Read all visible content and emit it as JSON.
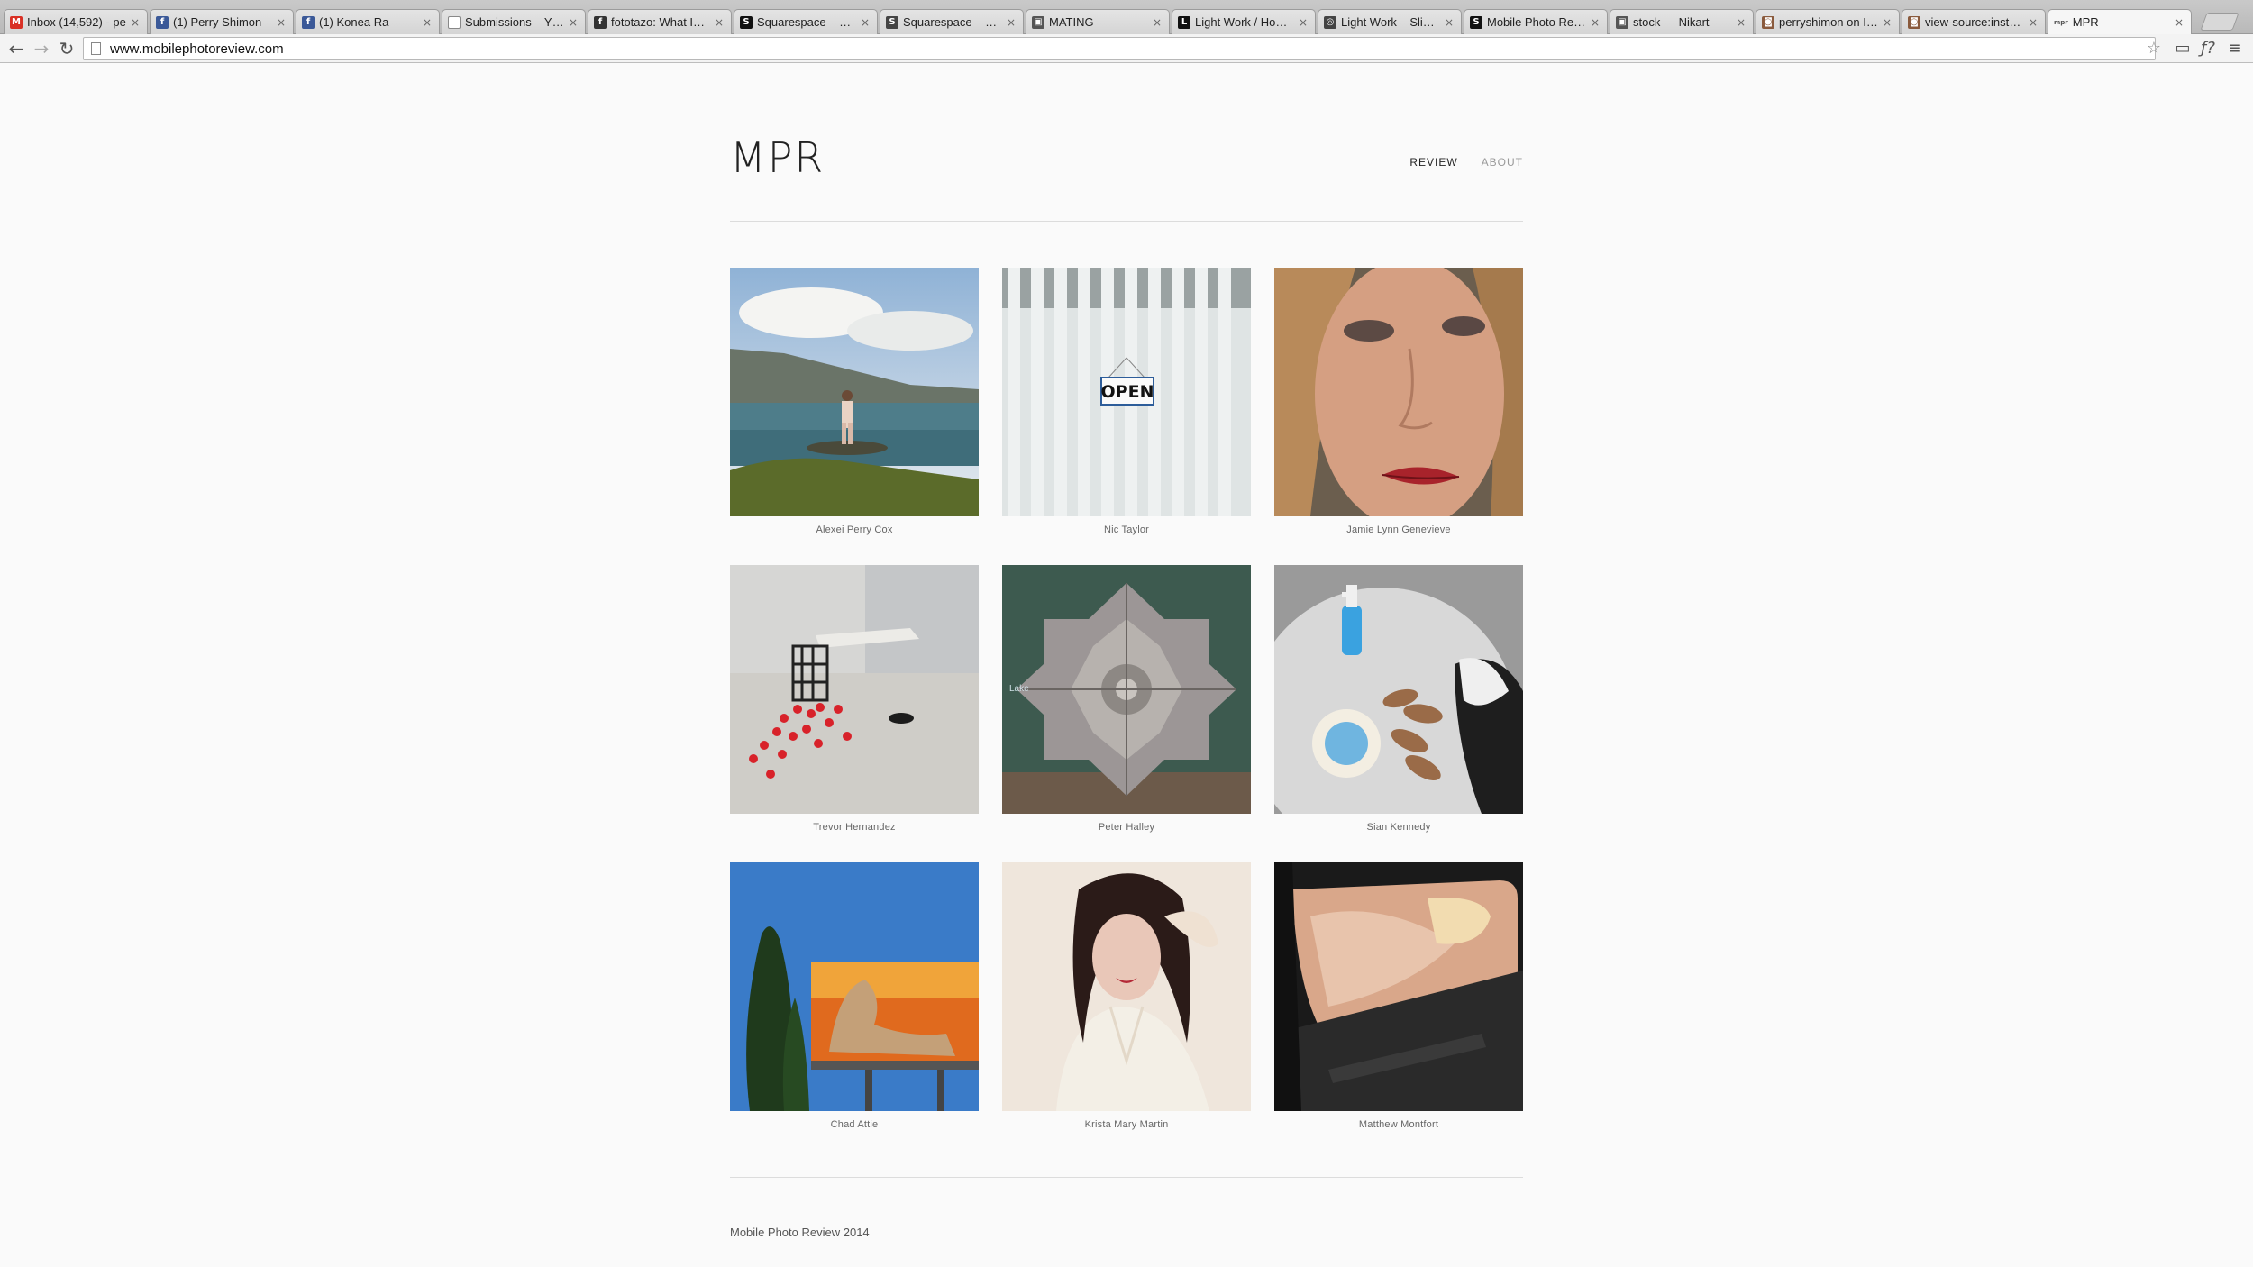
{
  "browser": {
    "tabs": [
      {
        "title": "Inbox (14,592) - pe",
        "icon": "gmail-icon",
        "glyph": "M",
        "color": "#d93025"
      },
      {
        "title": "(1) Perry Shimon",
        "icon": "facebook-icon",
        "glyph": "f",
        "color": "#3b5998"
      },
      {
        "title": "(1) Konea Ra",
        "icon": "facebook-icon",
        "glyph": "f",
        "color": "#3b5998"
      },
      {
        "title": "Submissions – YET m",
        "icon": "page-icon",
        "glyph": "",
        "color": "#ffffff"
      },
      {
        "title": "fototazo: What Is Pro",
        "icon": "fototazo-icon",
        "glyph": "f",
        "color": "#333333"
      },
      {
        "title": "Squarespace – Confi",
        "icon": "squarespace-icon",
        "glyph": "S",
        "color": "#111111"
      },
      {
        "title": "Squarespace – Confi",
        "icon": "squarespace-icon",
        "glyph": "S",
        "color": "#444444"
      },
      {
        "title": "MATING",
        "icon": "cube-icon",
        "glyph": "▣",
        "color": "#555555"
      },
      {
        "title": "Light Work / How to",
        "icon": "lightwork-icon",
        "glyph": "L",
        "color": "#111111"
      },
      {
        "title": "Light Work – SlideRo",
        "icon": "globe-icon",
        "glyph": "◎",
        "color": "#444444"
      },
      {
        "title": "Mobile Photo Review",
        "icon": "squarespace-icon",
        "glyph": "S",
        "color": "#111111"
      },
      {
        "title": "stock — Nikart",
        "icon": "cube-icon",
        "glyph": "▣",
        "color": "#555555"
      },
      {
        "title": "perryshimon on Insta",
        "icon": "instagram-icon",
        "glyph": "◙",
        "color": "#8a5a3c"
      },
      {
        "title": "view-source:instagra",
        "icon": "instagram-icon",
        "glyph": "◙",
        "color": "#8a5a3c"
      },
      {
        "title": "MPR",
        "icon": "mpr-icon",
        "glyph": "mpr",
        "color": "#999999"
      }
    ],
    "url": "www.mobilephotoreview.com"
  },
  "site": {
    "logo": "MPR",
    "nav": [
      {
        "label": "REVIEW",
        "current": true
      },
      {
        "label": "ABOUT",
        "current": false
      }
    ],
    "gallery": [
      {
        "name": "Alexei Perry Cox"
      },
      {
        "name": "Nic Taylor",
        "sign_text": "OPEN"
      },
      {
        "name": "Jamie Lynn Genevieve"
      },
      {
        "name": "Trevor Hernandez"
      },
      {
        "name": "Peter Halley",
        "map_text": "Lake"
      },
      {
        "name": "Sian Kennedy"
      },
      {
        "name": "Chad Attie"
      },
      {
        "name": "Krista Mary Martin"
      },
      {
        "name": "Matthew Montfort"
      }
    ],
    "footer": "Mobile Photo Review 2014"
  }
}
